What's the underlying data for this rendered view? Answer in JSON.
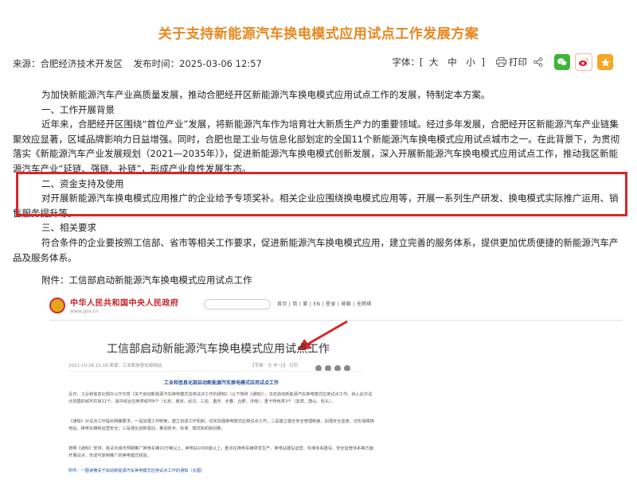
{
  "title": "关于支持新能源汽车换电模式应用试点工作发展方案",
  "meta": {
    "source": "来源：合肥经济技术开发区",
    "publish_time": "发布时间：2025-03-06 12:57"
  },
  "tools": {
    "font_label": "字体：[",
    "font_large": "大",
    "font_medium": "中",
    "font_small": "小",
    "font_close": "]",
    "print": "打印",
    "colors": {
      "wechat": "#3fb535",
      "weibo": "#e6162d",
      "qzone": "#f6a623"
    }
  },
  "content": {
    "intro": "为加快新能源汽车产业高质量发展，推动合肥经开区新能源汽车换电模式应用试点工作的发展，特制定本方案。",
    "s1_heading": "一、工作开展背景",
    "s1_para": "近年来，合肥经开区围绕“首位产业”发展，将新能源汽车作为培育壮大新质生产力的重要领域。经过多年发展，合肥经开区新能源汽车产业链集聚效应显著，区域品牌影响力日益增强。同时，合肥也是工业与信息化部划定的全国11个新能源汽车换电模式应用试点城市之一。在此背景下，为贯彻落实《新能源汽车产业发展规划（2021—2035年）》，促进新能源汽车换电模式创新发展，深入开展新能源汽车换电模式应用试点工作，推动我区新能源汽车产业“延链、强链、补链”，形成产业良性发展生态。",
    "s2_heading": "二、资金支持及使用",
    "s2_para": "对开展新能源汽车换电模式应用推广的企业给予专项奖补。相关企业应围绕换电模式应用等，开展一系列生产研发、换电模式实际推广运用、销售服务提升等。",
    "s3_heading": "三、相关要求",
    "s3_para": "符合条件的企业要按照工信部、省市等相关工作要求，促进新能源汽车换电模式应用，建立完善的服务体系，提供更加优质便捷的新能源汽车产品及服务体系。",
    "attachment": "附件：工信部启动新能源汽车换电模式应用试点工作"
  },
  "embedded": {
    "gov_name": "中华人民共和国中央人民政府",
    "gov_url": "www.gov.cn",
    "nav": "首页 | 简 | 繁 | EN | 登录 | 邮箱 | 无障碍",
    "article_title": "工信部启动新能源汽车换电模式应用试点工作",
    "article_meta": "2021-10-28 21:18   来源：工业和信息化部网站",
    "article_meta2": "【字体：大 中 小】  打印",
    "sub_title": "工业和信息化部启动新能源汽车换电模式应用试点工作",
    "p1": "近日，工业和信息化部办公厅印发《关于启动新能源汽车换电模式应用试点工作的通知》（以下简称《通知》），决定启动新能源汽车换电模式应用试点工作。纳入此次试点范围的城市共有11个，其中综合应用类城市8个（北京、南京、武汉、三亚、重庆、长春、合肥、济南），重卡特色类3个（宜宾、唐山、包头）。",
    "p2": "《通知》对试点工作提出明确要求，一是加强工作统筹，建立协调工作机制，切实加强换电模式应用试点工作；二是建立健全安全管理制度，加强安全监管，切实保障换电站、换电车辆和运营安全；三是强化创新驱动，推进技术、标准、模式和机制创新。",
    "p3": "按照《通知》安排，各试点城市预期推广换电车辆10万辆以上，换电站1000座以上，重点在换电车辆研发生产、换电站建设运营、标准体系建设、安全监管体系等方面开展试点，形成可复制推广的换电模式经验。",
    "p4": "附件：一图读懂关于启动新能源汽车换电模式应用试点工作的通知（长图）"
  }
}
